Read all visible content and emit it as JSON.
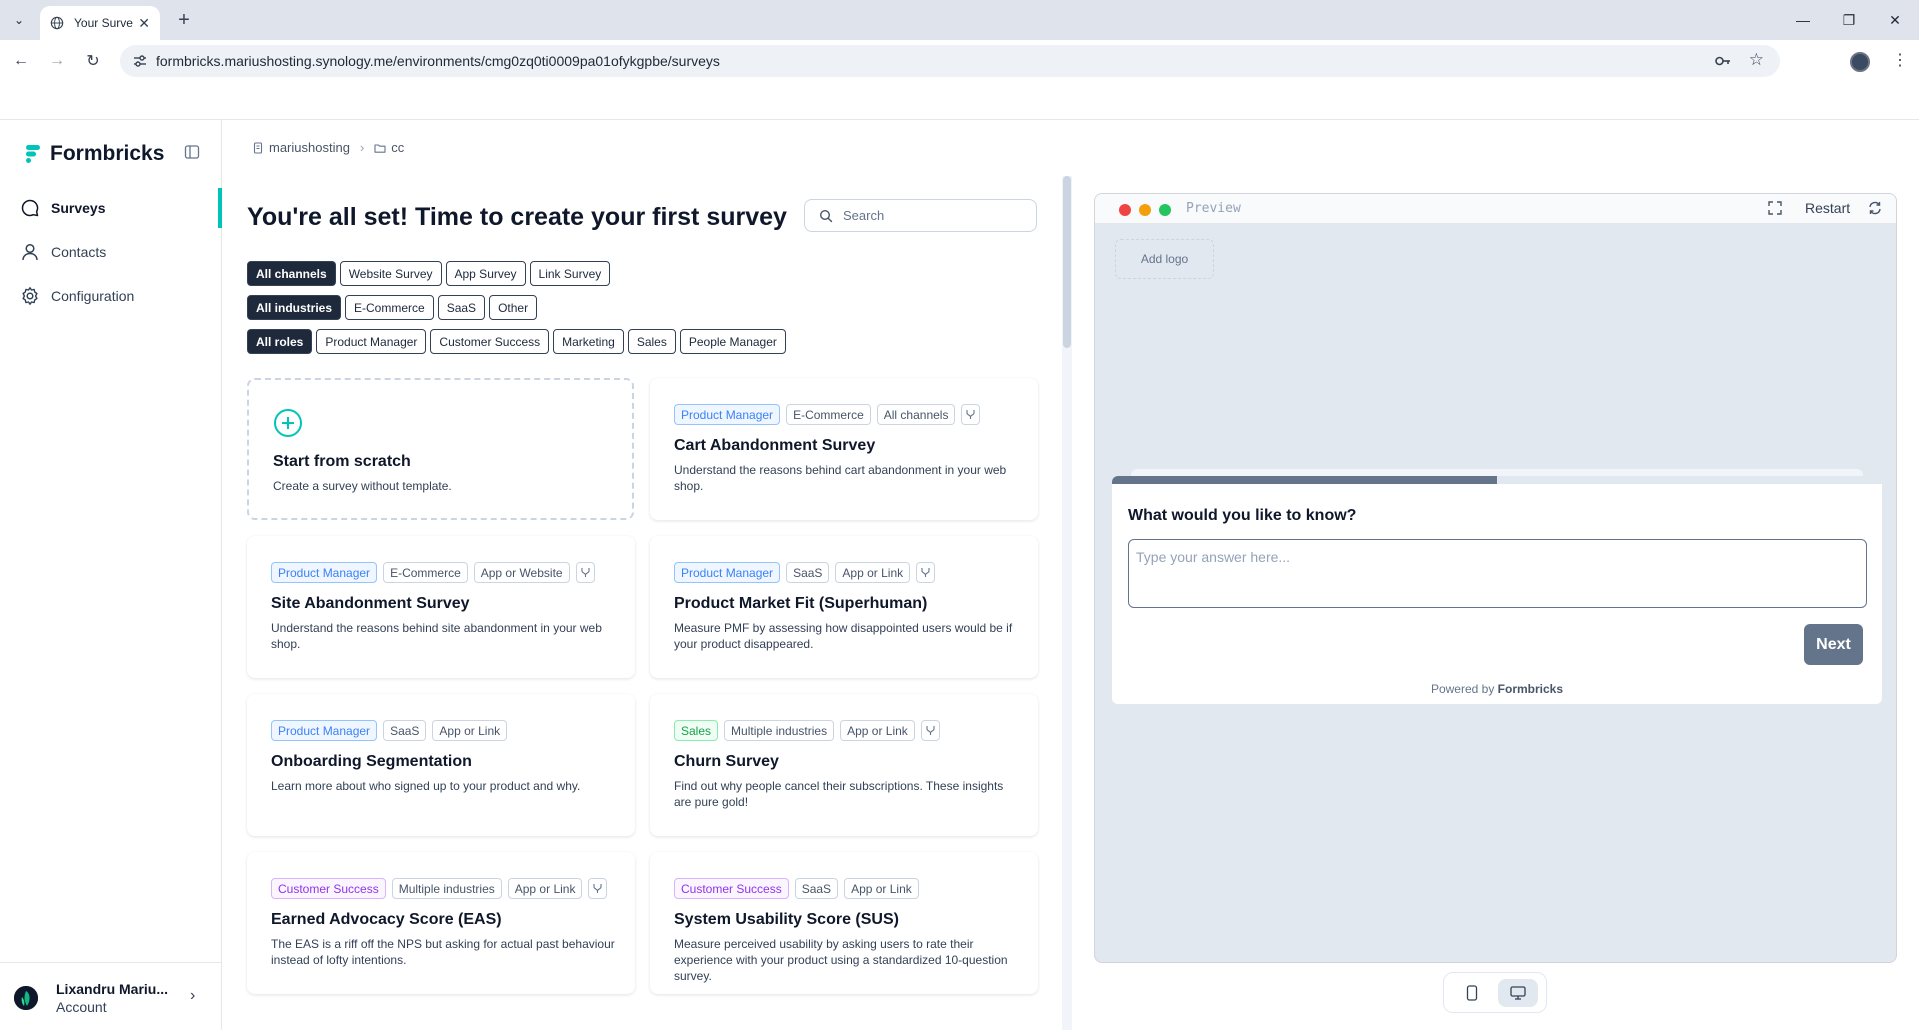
{
  "browser": {
    "tab_title": "Your Surve",
    "url": "formbricks.mariushosting.synology.me/environments/cmg0zq0ti0009pa01ofykgpbe/surveys"
  },
  "sidebar": {
    "brand": "Formbricks",
    "items": [
      {
        "label": "Surveys",
        "icon": "message-circle-icon",
        "active": true
      },
      {
        "label": "Contacts",
        "icon": "user-icon",
        "active": false
      },
      {
        "label": "Configuration",
        "icon": "gear-icon",
        "active": false
      }
    ],
    "user": {
      "name": "Lixandru Mariu...",
      "sub": "Account"
    }
  },
  "breadcrumb": {
    "org": "mariushosting",
    "project": "cc"
  },
  "main": {
    "title": "You're all set! Time to create your first survey",
    "search_placeholder": "Search",
    "filters": {
      "channels": [
        "All channels",
        "Website Survey",
        "App Survey",
        "Link Survey"
      ],
      "industries": [
        "All industries",
        "E-Commerce",
        "SaaS",
        "Other"
      ],
      "roles": [
        "All roles",
        "Product Manager",
        "Customer Success",
        "Marketing",
        "Sales",
        "People Manager"
      ]
    },
    "scratch": {
      "title": "Start from scratch",
      "desc": "Create a survey without template."
    },
    "templates": [
      {
        "tags": [
          "Product Manager",
          "E-Commerce",
          "All channels"
        ],
        "title": "Cart Abandonment Survey",
        "desc": "Understand the reasons behind cart abandonment in your web shop."
      },
      {
        "tags": [
          "Product Manager",
          "E-Commerce",
          "App or Website"
        ],
        "title": "Site Abandonment Survey",
        "desc": "Understand the reasons behind site abandonment in your web shop."
      },
      {
        "tags": [
          "Product Manager",
          "SaaS",
          "App or Link"
        ],
        "title": "Product Market Fit (Superhuman)",
        "desc": "Measure PMF by assessing how disappointed users would be if your product disappeared."
      },
      {
        "tags": [
          "Product Manager",
          "SaaS",
          "App or Link"
        ],
        "title": "Onboarding Segmentation",
        "desc": "Learn more about who signed up to your product and why."
      },
      {
        "tags": [
          "Sales",
          "Multiple industries",
          "App or Link"
        ],
        "title": "Churn Survey",
        "desc": "Find out why people cancel their subscriptions. These insights are pure gold!"
      },
      {
        "tags": [
          "Customer Success",
          "Multiple industries",
          "App or Link"
        ],
        "title": "Earned Advocacy Score (EAS)",
        "desc": "The EAS is a riff off the NPS but asking for actual past behaviour instead of lofty intentions."
      },
      {
        "tags": [
          "Customer Success",
          "SaaS",
          "App or Link"
        ],
        "title": "System Usability Score (SUS)",
        "desc": "Measure perceived usability by asking users to rate their experience with your product using a standardized 10-question survey."
      }
    ]
  },
  "preview": {
    "label": "Preview",
    "restart": "Restart",
    "add_logo": "Add logo",
    "progress": 0.5,
    "question": "What would you like to know?",
    "answer_placeholder": "Type your answer here...",
    "next": "Next",
    "powered_prefix": "Powered by",
    "powered_brand": "Formbricks"
  },
  "colors": {
    "accent": "#00c4b8",
    "dark": "#1e293b",
    "button": "#64748b"
  }
}
